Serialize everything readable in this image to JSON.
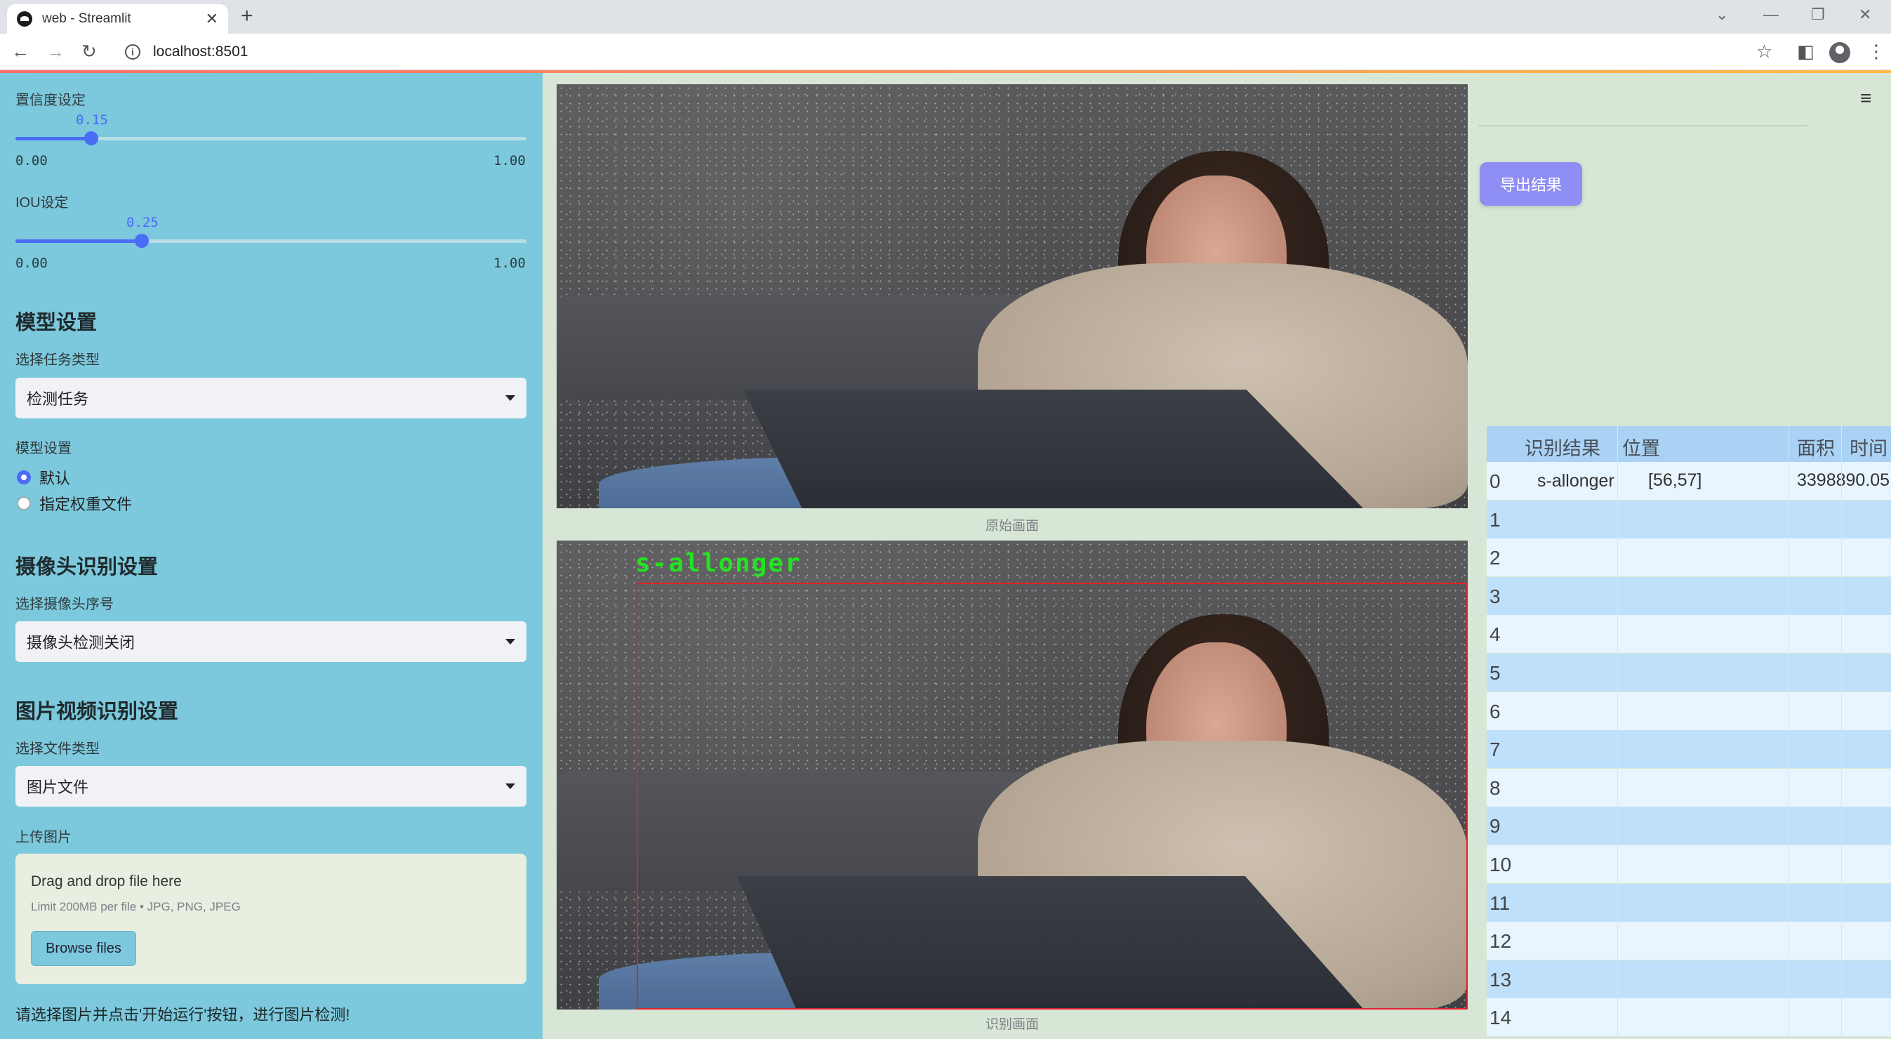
{
  "browser": {
    "tab_title": "web - Streamlit",
    "url": "localhost:8501",
    "new_tab": "+",
    "tab_close": "✕"
  },
  "sidebar": {
    "confidence": {
      "label": "置信度设定",
      "value": "0.15",
      "min": "0.00",
      "max": "1.00",
      "fraction": 0.15
    },
    "iou": {
      "label": "IOU设定",
      "value": "0.25",
      "min": "0.00",
      "max": "1.00",
      "fraction": 0.25
    },
    "model_header": "模型设置",
    "task_label": "选择任务类型",
    "task_value": "检测任务",
    "model_settings_label": "模型设置",
    "model_options": [
      "默认",
      "指定权重文件"
    ],
    "model_selected": 0,
    "camera_header": "摄像头识别设置",
    "camera_label": "选择摄像头序号",
    "camera_value": "摄像头检测关闭",
    "media_header": "图片视频识别设置",
    "filetype_label": "选择文件类型",
    "filetype_value": "图片文件",
    "upload_label": "上传图片",
    "upload_drop": "Drag and drop file here",
    "upload_limit": "Limit 200MB per file • JPG, PNG, JPEG",
    "browse_button": "Browse files",
    "hint": "请选择图片并点击'开始运行'按钮，进行图片检测!"
  },
  "main": {
    "original_caption": "原始画面",
    "detected_caption": "识别画面",
    "detection_label": "s-allonger"
  },
  "right": {
    "export_button": "导出结果",
    "table": {
      "headers": [
        "识别结果",
        "位置",
        "面积",
        "时间"
      ],
      "rows": [
        {
          "index": "0",
          "result": "s-allonger",
          "position": "[56,57]",
          "area": "3398890.05",
          "time": ""
        },
        {
          "index": "1",
          "result": "",
          "position": "",
          "area": "",
          "time": ""
        },
        {
          "index": "2",
          "result": "",
          "position": "",
          "area": "",
          "time": ""
        },
        {
          "index": "3",
          "result": "",
          "position": "",
          "area": "",
          "time": ""
        },
        {
          "index": "4",
          "result": "",
          "position": "",
          "area": "",
          "time": ""
        },
        {
          "index": "5",
          "result": "",
          "position": "",
          "area": "",
          "time": ""
        },
        {
          "index": "6",
          "result": "",
          "position": "",
          "area": "",
          "time": ""
        },
        {
          "index": "7",
          "result": "",
          "position": "",
          "area": "",
          "time": ""
        },
        {
          "index": "8",
          "result": "",
          "position": "",
          "area": "",
          "time": ""
        },
        {
          "index": "9",
          "result": "",
          "position": "",
          "area": "",
          "time": ""
        },
        {
          "index": "10",
          "result": "",
          "position": "",
          "area": "",
          "time": ""
        },
        {
          "index": "11",
          "result": "",
          "position": "",
          "area": "",
          "time": ""
        },
        {
          "index": "12",
          "result": "",
          "position": "",
          "area": "",
          "time": ""
        },
        {
          "index": "13",
          "result": "",
          "position": "",
          "area": "",
          "time": ""
        },
        {
          "index": "14",
          "result": "",
          "position": "",
          "area": "",
          "time": ""
        }
      ]
    }
  },
  "colors": {
    "sidebar_bg": "#7cc8dc",
    "accent": "#4a6cf7",
    "export_button": "#8f8ef5",
    "detection_box": "#e0202a",
    "detection_text": "#22e41f",
    "table_header": "#a9d2f5"
  },
  "icons": [
    "streamlit-favicon",
    "back-arrow-icon",
    "forward-arrow-icon",
    "reload-icon",
    "info-icon",
    "star-icon",
    "sidepanel-icon",
    "profile-icon",
    "menu-dots-icon",
    "hamburger-menu-icon",
    "chevron-down-icon",
    "minimize-icon",
    "restore-icon",
    "close-icon"
  ]
}
